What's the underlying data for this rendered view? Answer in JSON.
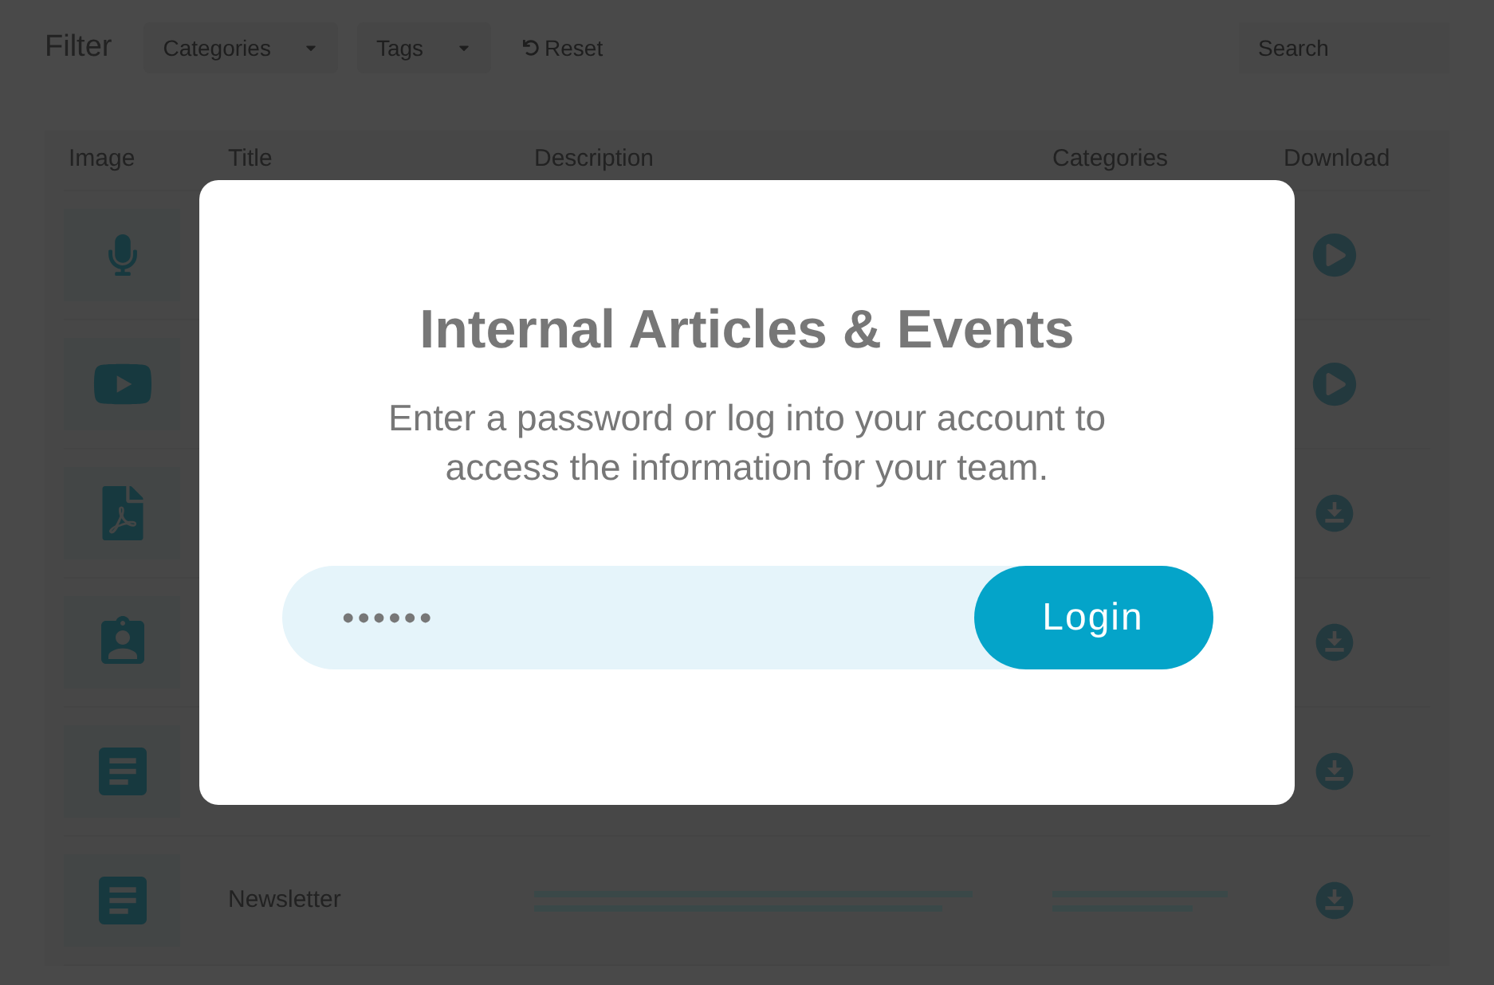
{
  "toolbar": {
    "title": "Filter",
    "dropdowns": [
      "Categories",
      "Tags"
    ],
    "reset": "Reset",
    "search": {
      "placeholder": "Search"
    }
  },
  "table": {
    "columns": [
      "Image",
      "Title",
      "Description",
      "Categories",
      "Download"
    ],
    "rows": [
      {
        "image": {
          "kind": "audio"
        },
        "download": {
          "kind": "play"
        }
      },
      {
        "image": {
          "kind": "video"
        },
        "download": {
          "kind": "play"
        }
      },
      {
        "image": {
          "kind": "pdf"
        },
        "download": {
          "kind": "download"
        }
      },
      {
        "image": {
          "kind": "form"
        },
        "download": {
          "kind": "download"
        }
      },
      {
        "image": {
          "kind": "document"
        },
        "download": {
          "kind": "download"
        }
      },
      {
        "image": {
          "kind": "document"
        },
        "title": "Newsletter",
        "download": {
          "kind": "download"
        }
      }
    ]
  },
  "modal": {
    "title": "Internal Articles & Events",
    "message": "Enter a password or log into your account to access the information for your team.",
    "password": "••••••",
    "button": "Login"
  }
}
